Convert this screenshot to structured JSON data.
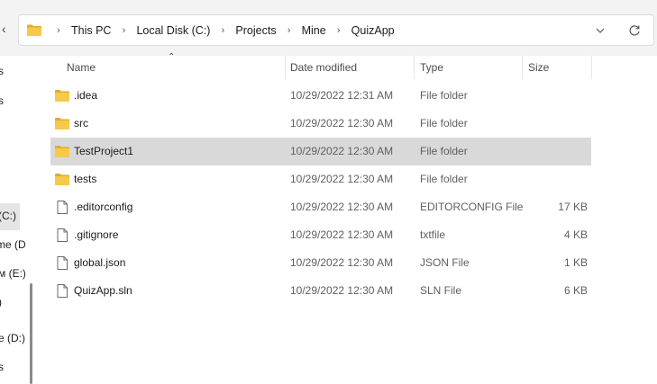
{
  "address_bar": {
    "crumbs": [
      "This PC",
      "Local Disk (C:)",
      "Projects",
      "Mine",
      "QuizApp"
    ],
    "separator": "›"
  },
  "nav": {
    "fragments": [
      "s",
      "s",
      "(C:)",
      "me (D",
      "м (E:)",
      ")",
      "e (D:)",
      "s"
    ]
  },
  "columns": {
    "name": "Name",
    "date": "Date modified",
    "type": "Type",
    "size": "Size"
  },
  "files": [
    {
      "name": ".idea",
      "date": "10/29/2022 12:31 AM",
      "type": "File folder",
      "size": "",
      "icon": "folder-icon"
    },
    {
      "name": "src",
      "date": "10/29/2022 12:30 AM",
      "type": "File folder",
      "size": "",
      "icon": "folder-icon"
    },
    {
      "name": "TestProject1",
      "date": "10/29/2022 12:30 AM",
      "type": "File folder",
      "size": "",
      "icon": "folder-icon",
      "selected": true
    },
    {
      "name": "tests",
      "date": "10/29/2022 12:30 AM",
      "type": "File folder",
      "size": "",
      "icon": "folder-icon"
    },
    {
      "name": ".editorconfig",
      "date": "10/29/2022 12:30 AM",
      "type": "EDITORCONFIG File",
      "size": "17 KB",
      "icon": "file-icon"
    },
    {
      "name": ".gitignore",
      "date": "10/29/2022 12:30 AM",
      "type": "txtfile",
      "size": "4 KB",
      "icon": "file-icon"
    },
    {
      "name": "global.json",
      "date": "10/29/2022 12:30 AM",
      "type": "JSON File",
      "size": "1 KB",
      "icon": "file-icon"
    },
    {
      "name": "QuizApp.sln",
      "date": "10/29/2022 12:30 AM",
      "type": "SLN File",
      "size": "6 KB",
      "icon": "file-icon"
    }
  ],
  "colors": {
    "folder": "#f7c948",
    "folder_dark": "#e6a92a",
    "selected_row": "#d9d9d9"
  }
}
